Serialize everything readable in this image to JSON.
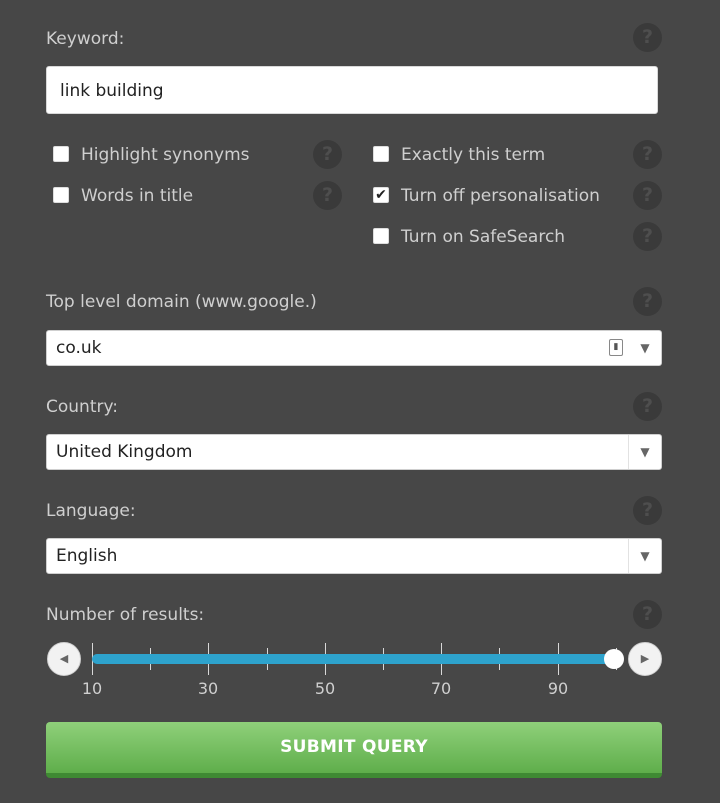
{
  "keyword": {
    "label": "Keyword:",
    "value": "link building"
  },
  "options": {
    "highlight_synonyms": {
      "label": "Highlight synonyms",
      "checked": false
    },
    "words_in_title": {
      "label": "Words in title",
      "checked": false
    },
    "exactly_this_term": {
      "label": "Exactly this term",
      "checked": false
    },
    "turn_off_personalisation": {
      "label": "Turn off personalisation",
      "checked": true
    },
    "turn_on_safesearch": {
      "label": "Turn on SafeSearch",
      "checked": false
    }
  },
  "tld": {
    "label": "Top level domain (www.google.)",
    "value": "co.uk"
  },
  "country": {
    "label": "Country:",
    "value": "United Kingdom"
  },
  "language": {
    "label": "Language:",
    "value": "English"
  },
  "results": {
    "label": "Number of results:",
    "value": 100,
    "range": [
      10,
      100
    ],
    "tick_labels": [
      "10",
      "30",
      "50",
      "70",
      "90"
    ]
  },
  "submit": {
    "label": "SUBMIT QUERY"
  },
  "icons": {
    "help": "?",
    "check": "✔",
    "dropdown": "▼",
    "slider_prev": "◀",
    "slider_next": "▶"
  },
  "colors": {
    "slider_fill": "#2ea3cd",
    "submit_green": "#6fbd5a",
    "background": "#474747"
  }
}
